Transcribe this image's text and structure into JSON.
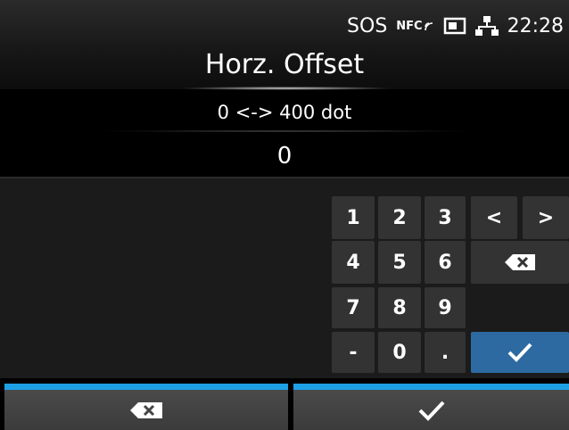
{
  "status_bar": {
    "sos": "SOS",
    "nfc": "NFC",
    "time": "22:28",
    "icons": [
      "nfc-icon",
      "sd-card-icon",
      "network-icon"
    ]
  },
  "title": "Horz. Offset",
  "range": "0 <-> 400 dot",
  "value": "0",
  "keypad": {
    "keys": [
      "1",
      "2",
      "3",
      "4",
      "5",
      "6",
      "7",
      "8",
      "9",
      "-",
      "0",
      "."
    ],
    "left": "<",
    "right": ">",
    "backspace_icon": "backspace-icon",
    "enter_icon": "checkmark-icon"
  },
  "footer": {
    "left_icon": "backspace-icon",
    "right_icon": "checkmark-icon"
  },
  "colors": {
    "accent": "#1ea0e6",
    "confirm_key": "#2d6aa1",
    "key": "#333333"
  }
}
